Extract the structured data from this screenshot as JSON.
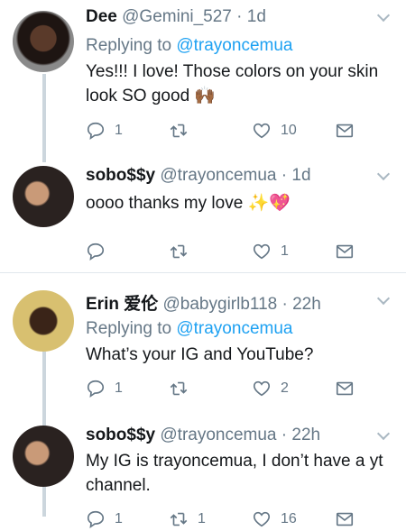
{
  "tweets": [
    {
      "name": "Dee",
      "handle": "@Gemini_527",
      "dot": "·",
      "time": "1d",
      "replying_prefix": "Replying to ",
      "replying_to": "@trayoncemua",
      "text": "Yes!!! I love! Those colors on your skin look SO good 🙌🏾",
      "replies": "1",
      "retweets": "",
      "likes": "10"
    },
    {
      "name": "sobo$$y",
      "handle": "@trayoncemua",
      "dot": "·",
      "time": "1d",
      "text": "oooo thanks my love ✨💖",
      "replies": "",
      "retweets": "",
      "likes": "1"
    },
    {
      "name": "Erin 爱伦",
      "handle": "@babygirlb118",
      "dot": "·",
      "time": "22h",
      "replying_prefix": "Replying to ",
      "replying_to": "@trayoncemua",
      "text": "What’s your IG and YouTube?",
      "replies": "1",
      "retweets": "",
      "likes": "2"
    },
    {
      "name": "sobo$$y",
      "handle": "@trayoncemua",
      "dot": "·",
      "time": "22h",
      "text": "My IG is trayoncemua, I don’t have a yt channel.",
      "replies": "1",
      "retweets": "1",
      "likes": "16"
    }
  ],
  "colors": {
    "link": "#1da1f2",
    "muted": "#657786",
    "thread": "#ccd6dd"
  },
  "icons": [
    "reply-icon",
    "retweet-icon",
    "like-icon",
    "dm-icon",
    "chevron-down-icon"
  ]
}
